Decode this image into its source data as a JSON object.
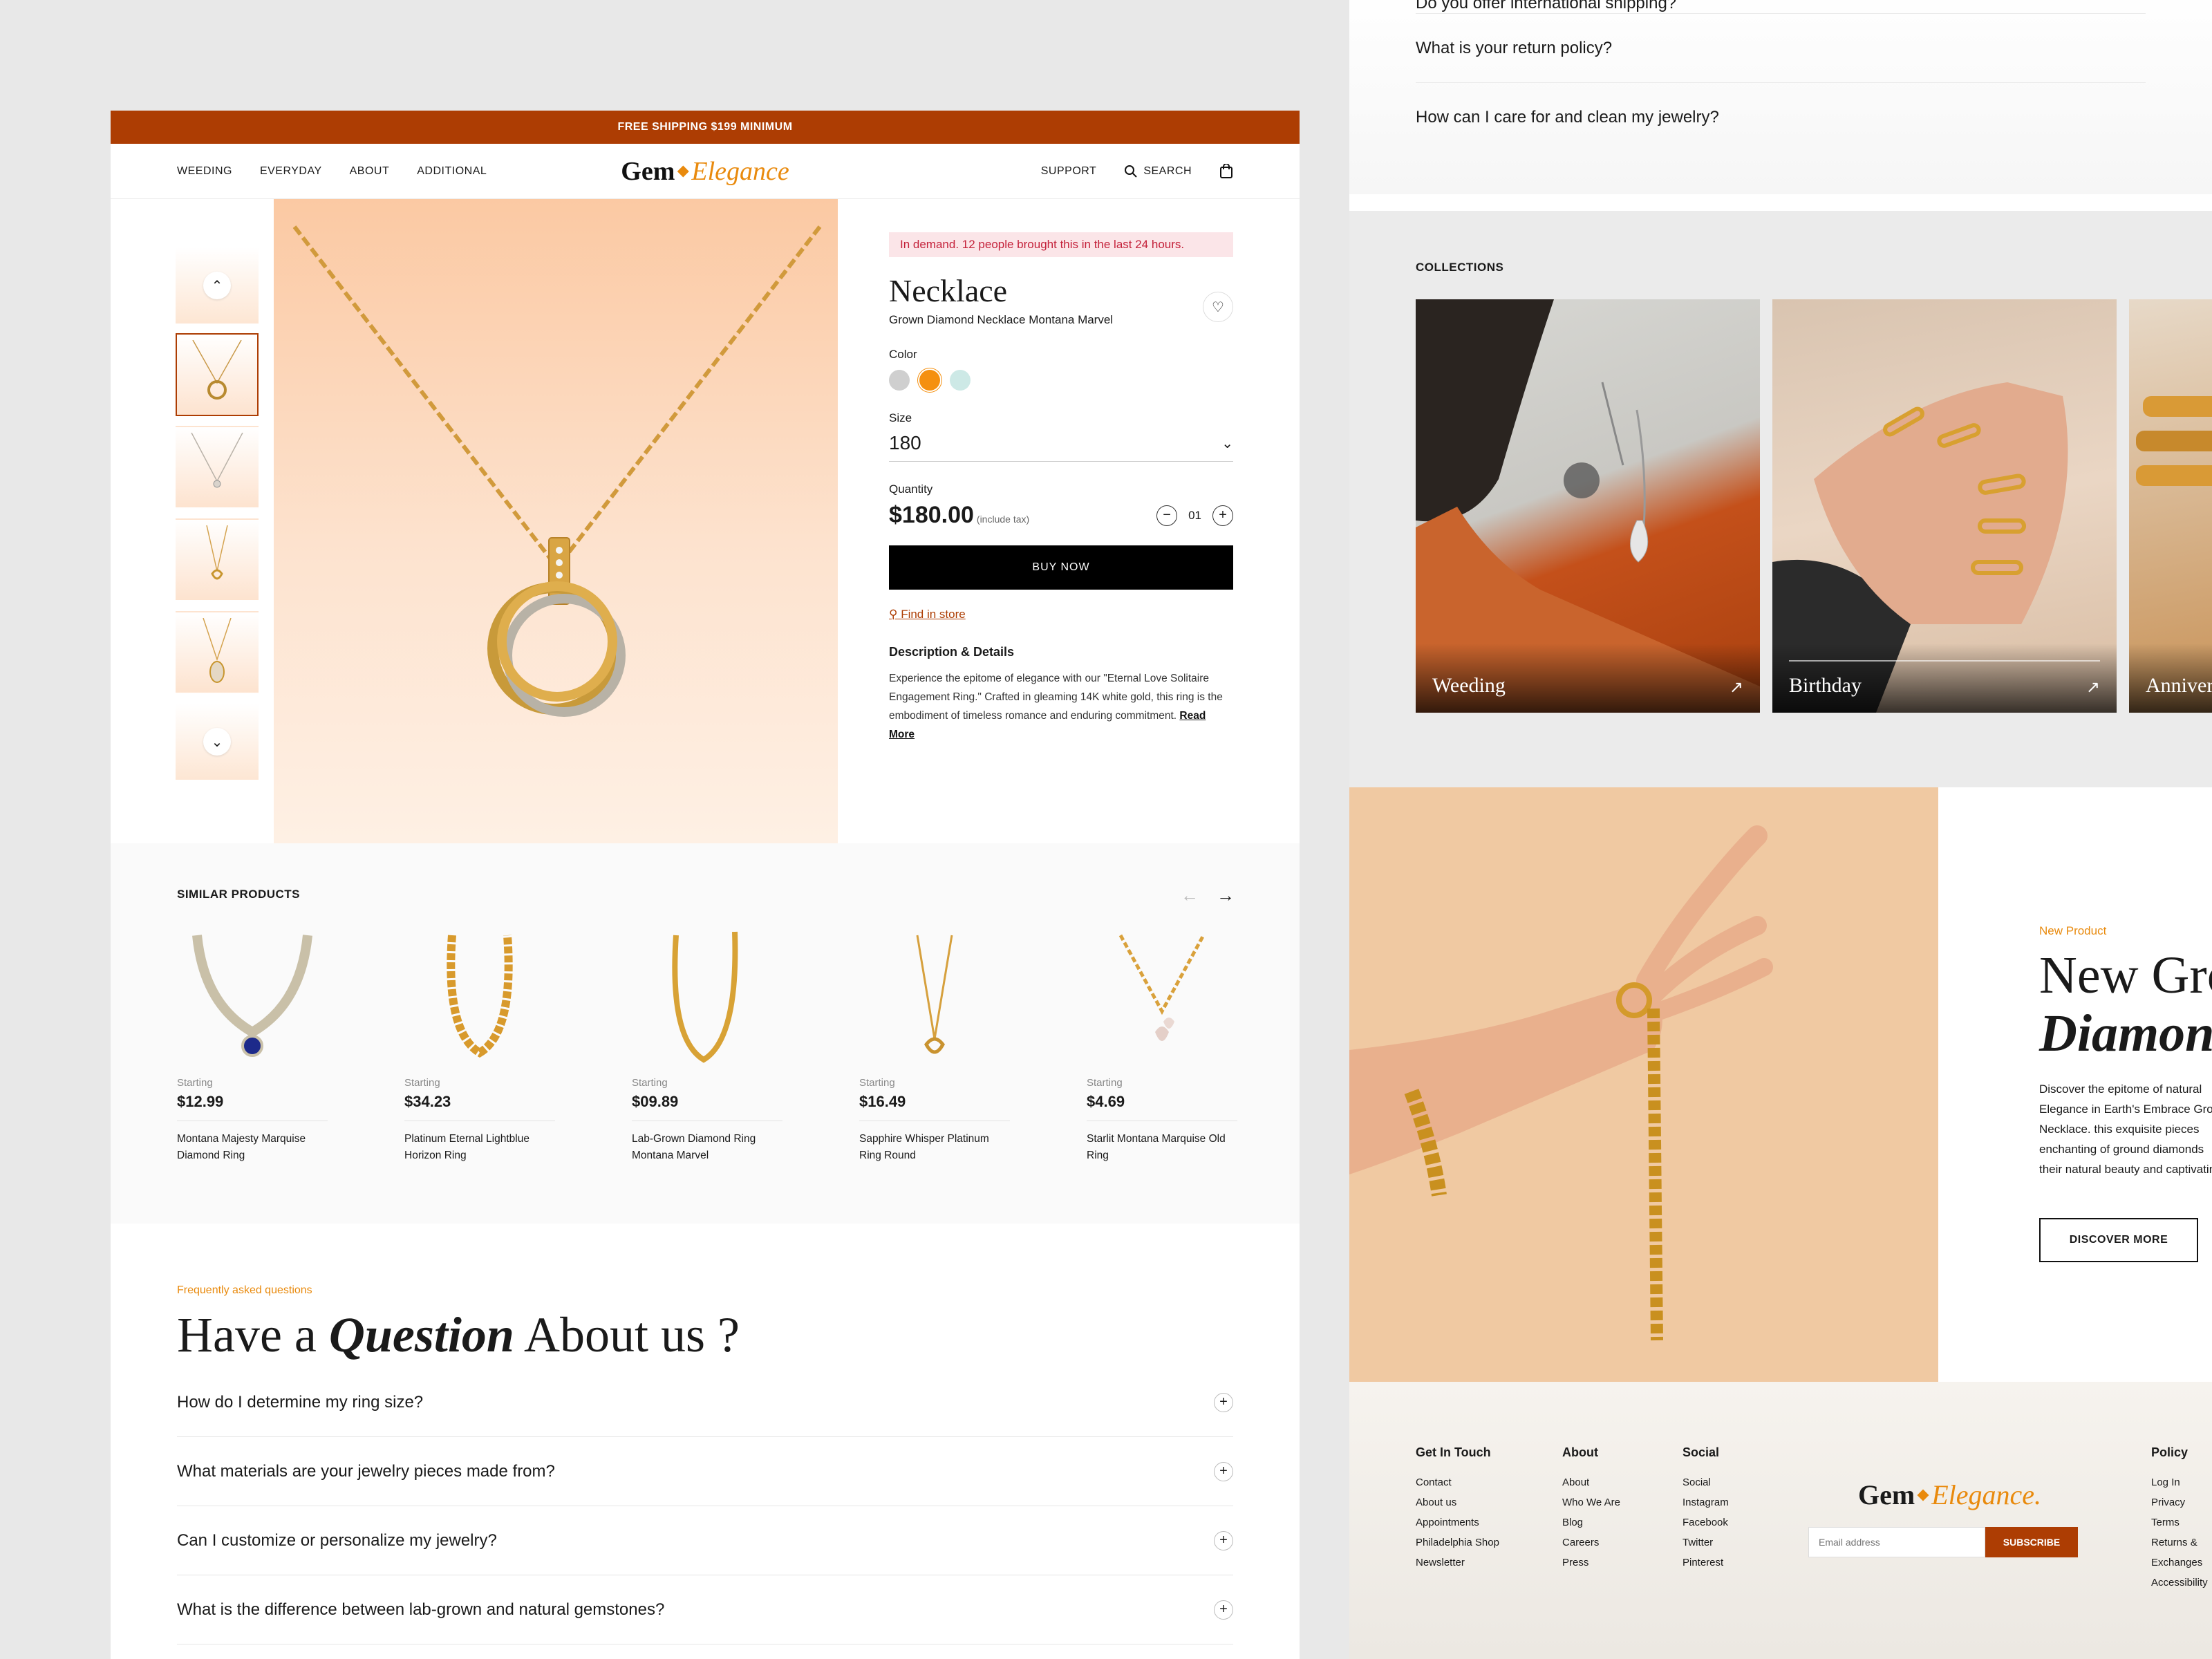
{
  "promo": "FREE SHIPPING $199 MINIMUM",
  "nav": {
    "left": [
      "WEEDING",
      "EVERYDAY",
      "ABOUT",
      "ADDITIONAL"
    ],
    "logo_a": "Gem",
    "logo_b": "Elegance",
    "support": "SUPPORT",
    "search": "SEARCH"
  },
  "product": {
    "demand": "In demand. 12 people brought this in the last 24 hours.",
    "title": "Necklace",
    "subtitle": "Grown Diamond Necklace Montana Marvel",
    "color_label": "Color",
    "colors": [
      "#cfcfcf",
      "#f5900f",
      "#cde9e6"
    ],
    "size_label": "Size",
    "size_value": "180",
    "qty_label": "Quantity",
    "price": "$180.00",
    "tax": "(include tax)",
    "qty": "01",
    "buy": "BUY NOW",
    "find": "Find in store",
    "desc_heading": "Description & Details",
    "desc": "Experience the epitome of elegance with our \"Eternal Love Solitaire Engagement Ring.\" Crafted in gleaming 14K white gold, this ring is the embodiment of timeless romance and enduring commitment.",
    "read_more": "Read More"
  },
  "similar": {
    "heading": "SIMILAR PRODUCTS",
    "items": [
      {
        "start": "Starting",
        "price": "$12.99",
        "name": "Montana Majesty Marquise Diamond Ring"
      },
      {
        "start": "Starting",
        "price": "$34.23",
        "name": "Platinum Eternal Lightblue Horizon Ring"
      },
      {
        "start": "Starting",
        "price": "$09.89",
        "name": "Lab-Grown Diamond Ring Montana Marvel"
      },
      {
        "start": "Starting",
        "price": "$16.49",
        "name": "Sapphire Whisper Platinum Ring Round"
      },
      {
        "start": "Starting",
        "price": "$4.69",
        "name": "Starlit Montana Marquise Old Ring"
      }
    ]
  },
  "faq": {
    "kicker": "Frequently asked  questions",
    "title_a": "Have a ",
    "title_b": "Question",
    "title_c": " About us ?",
    "items": [
      "How do I determine my ring size?",
      "What materials are your jewelry pieces made from?",
      "Can I customize or personalize my jewelry?",
      "What is the difference between lab-grown and natural gemstones?"
    ]
  },
  "faq2": {
    "partial": "Do you offer international shipping?",
    "items": [
      "What is your return policy?",
      "How can I care for and clean my jewelry?"
    ]
  },
  "collections": {
    "heading": "COLLECTIONS",
    "items": [
      "Weeding",
      "Birthday",
      "Anniversary"
    ]
  },
  "feature": {
    "kicker": "New Product",
    "title_a": "New Grown",
    "title_b": "Diamond",
    "desc": [
      "Discover the epitome of natural",
      "Elegance in Earth's Embrace Grown",
      "Necklace. this exquisite pieces",
      "enchanting of ground diamonds",
      "their natural beauty and captivating"
    ],
    "button": "DISCOVER MORE"
  },
  "footer": {
    "cols": [
      {
        "h": "Get In Touch",
        "links": [
          "Contact",
          "About us",
          "Appointments",
          "Philadelphia Shop",
          "Newsletter"
        ]
      },
      {
        "h": "About",
        "links": [
          "About",
          "Who We Are",
          "Blog",
          "Careers",
          "Press"
        ]
      },
      {
        "h": "Social",
        "links": [
          "Social",
          "Instagram",
          "Facebook",
          "Twitter",
          "Pinterest"
        ]
      },
      {
        "h": "Policy",
        "links": [
          "Log In",
          "Privacy",
          "Terms",
          "Returns & Exchanges",
          "Accessibility"
        ]
      }
    ],
    "logo_a": "Gem",
    "logo_b": "Elegance.",
    "email_placeholder": "Email address",
    "subscribe": "SUBSCRIBE"
  }
}
